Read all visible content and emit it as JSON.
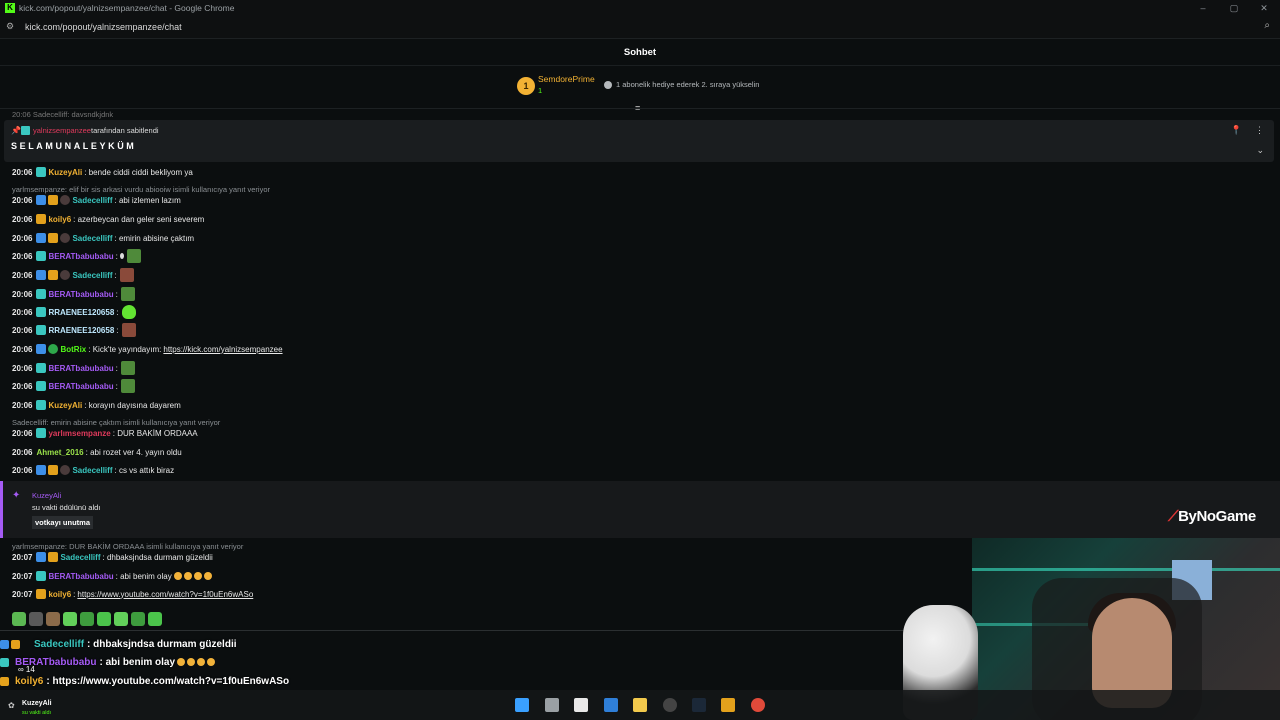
{
  "window": {
    "title": "kick.com/popout/yalnizsempanzee/chat - Google Chrome",
    "url": "kick.com/popout/yalnizsempanzee/chat"
  },
  "chat": {
    "header": "Sohbet"
  },
  "leaderboard": {
    "rank": "1",
    "name": "SemdorePrime",
    "count": "1",
    "gift_prompt": "1 abonelik hediye ederek 2. sıraya yükselin"
  },
  "partial_message": "20:06 Sadecelliff: davsndkjdnk",
  "pinned": {
    "pinner": "yalnizsempanzee",
    "pinned_by_text": "tarafından sabitlendi",
    "message": "SELAMUNALEYKÜM"
  },
  "messages": [
    {
      "time": "20:06",
      "user": "KuzeyAli",
      "text": "bende ciddi ciddi bekliyom ya"
    },
    {
      "reply": "yarlmsempanze: elif bir sis arkasi vurdu abiooiw isimli kullanıcıya yanıt veriyor"
    },
    {
      "time": "20:06",
      "user": "Sadecelliff",
      "text": "abi izlemen lazım"
    },
    {
      "time": "20:06",
      "user": "koily6",
      "text": "azerbeycan dan geler seni severem"
    },
    {
      "time": "20:06",
      "user": "Sadecelliff",
      "text": "emirin abisine çaktım"
    },
    {
      "time": "20:06",
      "user": "BERATbabubabu",
      "text": ""
    },
    {
      "time": "20:06",
      "user": "Sadecelliff",
      "text": ""
    },
    {
      "time": "20:06",
      "user": "BERATbabubabu",
      "text": ""
    },
    {
      "time": "20:06",
      "user": "RRAENEE120658",
      "text": ""
    },
    {
      "time": "20:06",
      "user": "RRAENEE120658",
      "text": ""
    },
    {
      "time": "20:06",
      "user": "BotRix",
      "text": "Kick'te yayındayım:",
      "link": "https://kick.com/yalnizsempanzee"
    },
    {
      "time": "20:06",
      "user": "BERATbabubabu",
      "text": ""
    },
    {
      "time": "20:06",
      "user": "BERATbabubabu",
      "text": ""
    },
    {
      "time": "20:06",
      "user": "KuzeyAli",
      "text": "korayın dayısına dayarem"
    },
    {
      "reply": "Sadecelliff: emirin abisine çaktım isimli kullanıcıya yanıt veriyor"
    },
    {
      "time": "20:06",
      "user": "yarlımsempanze",
      "text": "DUR BAKİM ORDAAA"
    },
    {
      "time": "20:06",
      "user": "Ahmet_2016",
      "text": "abi rozet ver 4. yayın oldu"
    },
    {
      "time": "20:06",
      "user": "Sadecelliff",
      "text": "cs vs attık biraz"
    },
    {
      "reply": "yarlmsempanze: DUR BAKİM ORDAAA isimli kullanıcıya yanıt veriyor"
    },
    {
      "time": "20:07",
      "user": "Sadecelliff",
      "text": "dhbaksjndsa durmam güzeldii"
    },
    {
      "time": "20:07",
      "user": "BERATbabubabu",
      "text": "abi benim olay"
    },
    {
      "time": "20:07",
      "user": "koily6",
      "text": "",
      "link": "https://www.youtube.com/watch?v=1f0uEn6wASo"
    }
  ],
  "redeem": {
    "user": "KuzeyAli",
    "action": "su vakti ödülünü aldı",
    "input": "votkayı unutma"
  },
  "brand": "ByNoGame",
  "overlay": [
    {
      "user": "Sadecelliff",
      "text": "dhbaksjndsa durmam güzeldii"
    },
    {
      "user": "BERATbabubabu",
      "text": "abi benim olay"
    },
    {
      "user": "koily6",
      "text": "https://www.youtube.com/watch?v=1f0uEn6wASo"
    }
  ],
  "overlay_stats": "∞   14",
  "taskbar": {
    "user": "KuzeyAli",
    "sub": "su vakti aldı"
  },
  "colors": {
    "kick_green": "#53fc18",
    "gold": "#f2b233",
    "purple": "#a55bf5",
    "teal_user": "#3ac7c0",
    "red_user": "#e03a5c",
    "background": "#0b0e0f"
  }
}
